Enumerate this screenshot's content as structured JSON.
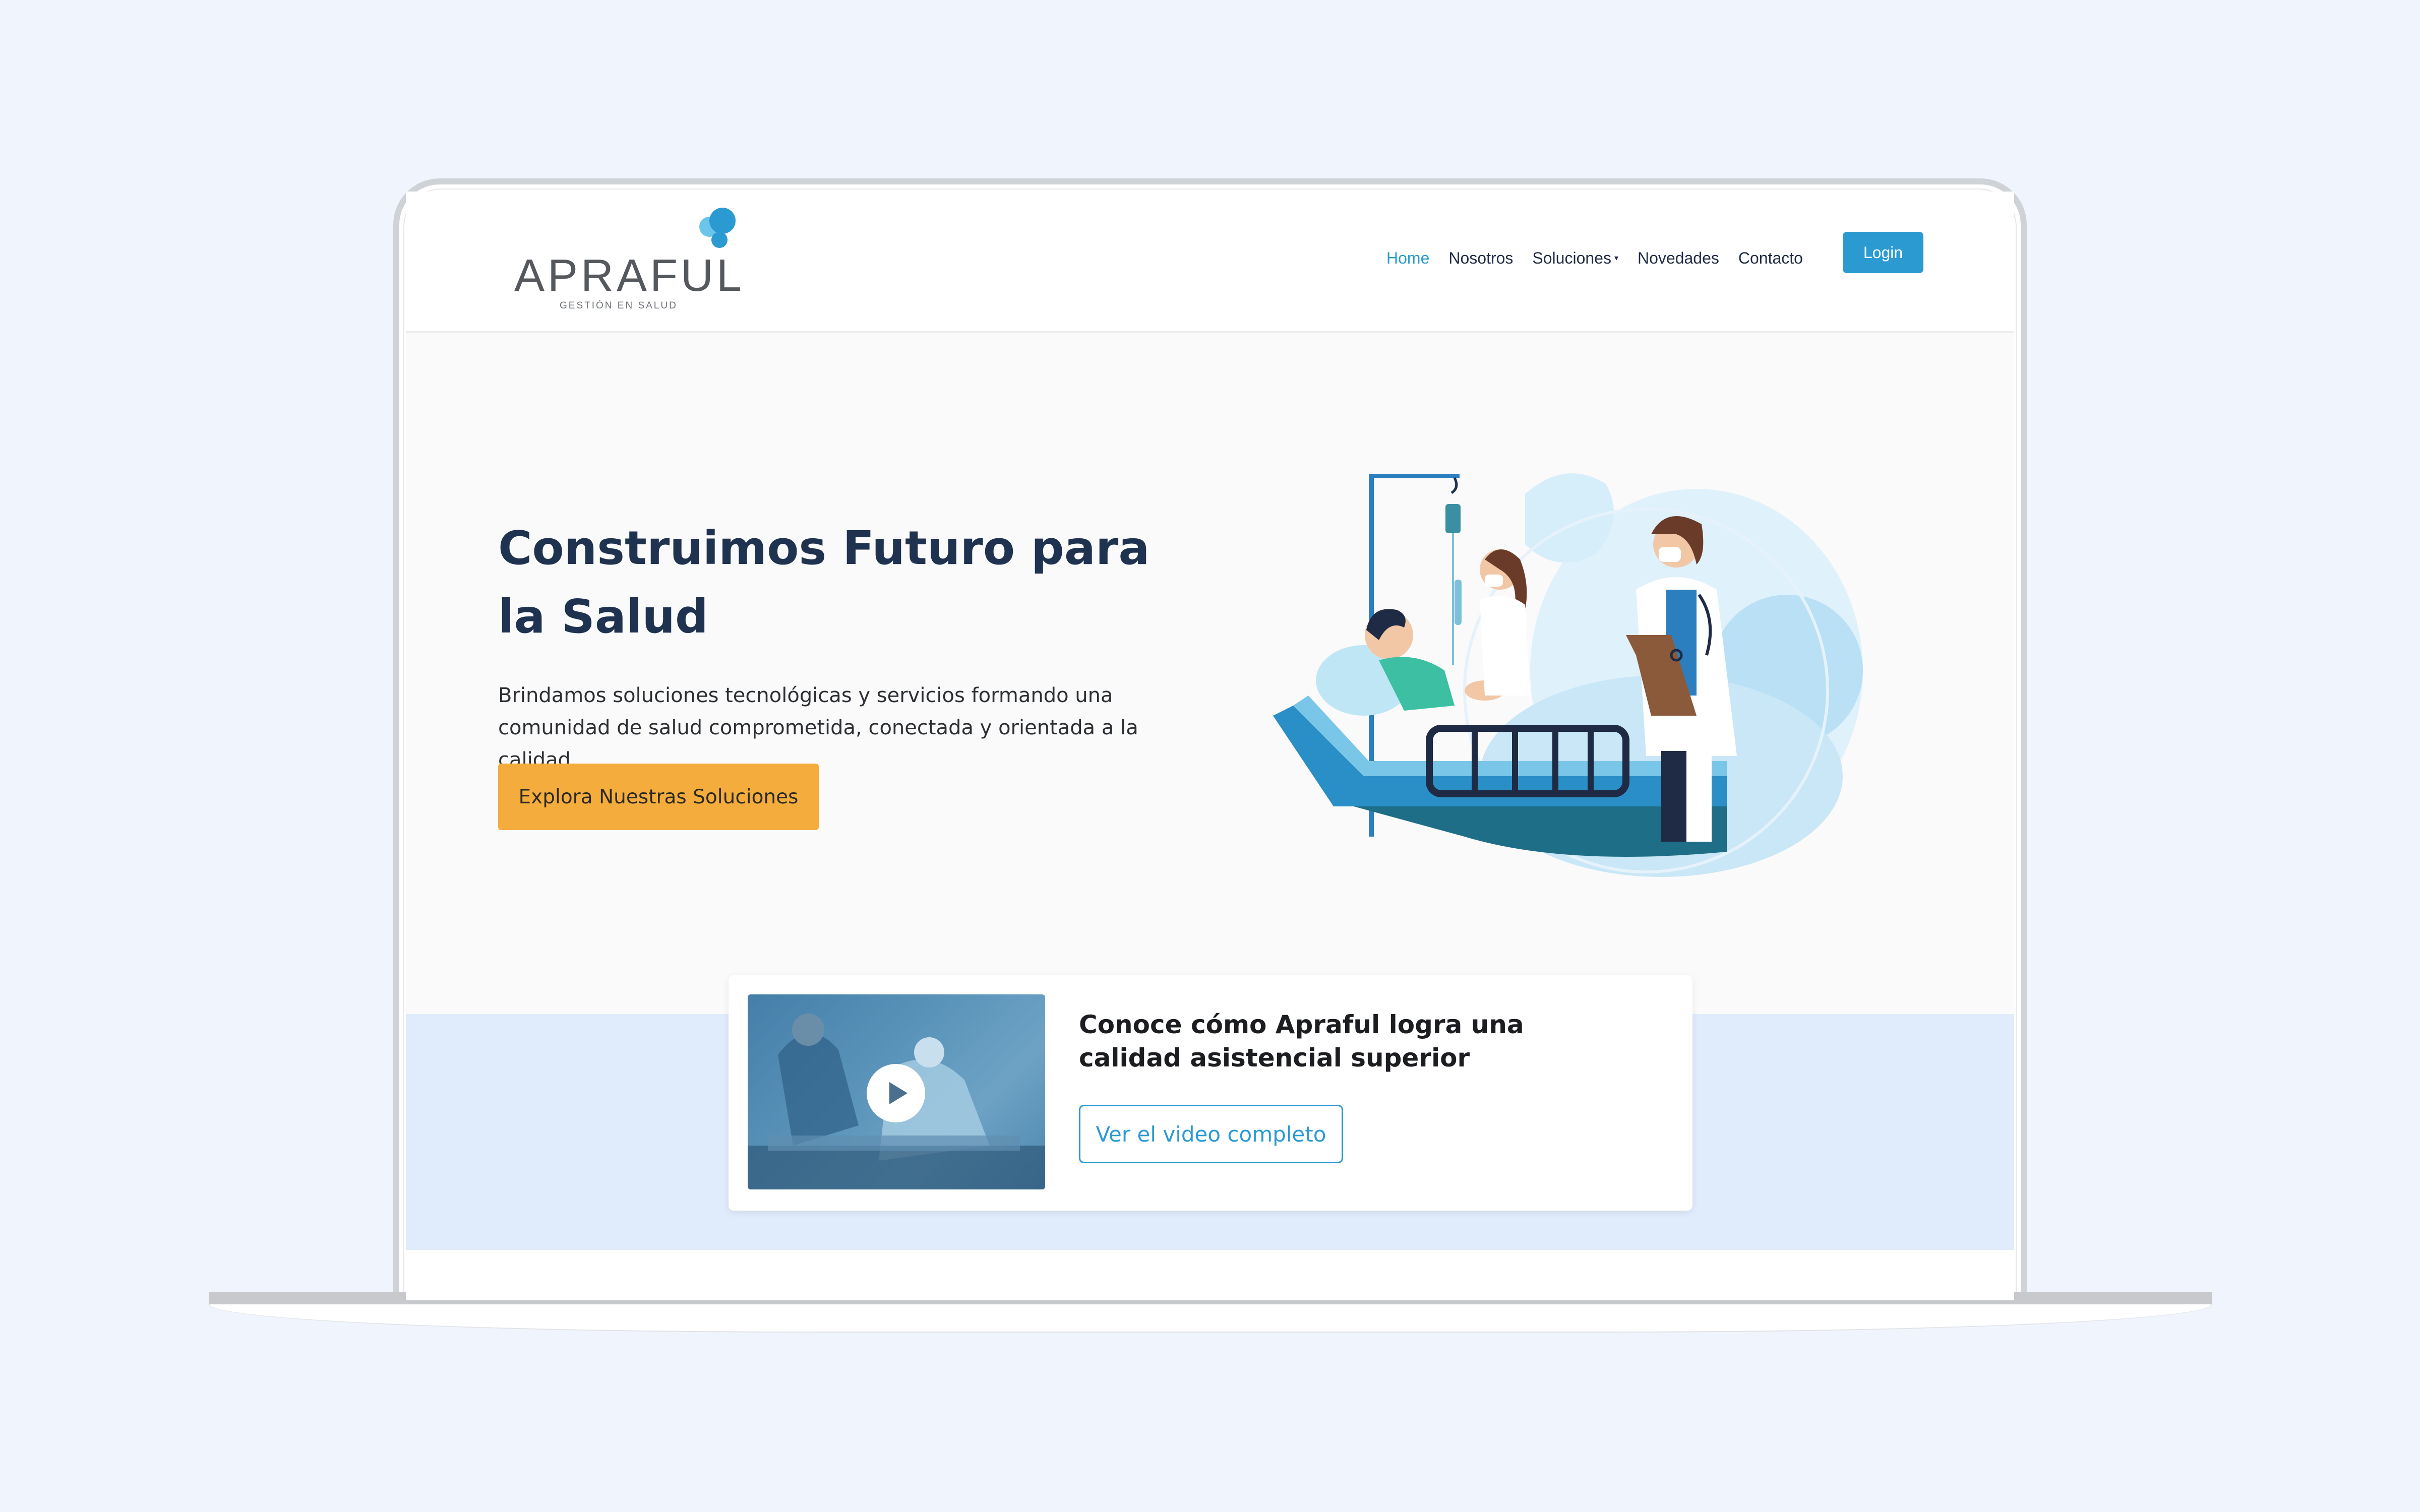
{
  "brand": {
    "name": "APRAFUL",
    "tagline": "GESTIÓN EN SALUD",
    "accent": "#2b9ad1",
    "cta_color": "#f4ad3d",
    "heading_color": "#1f3350"
  },
  "nav": {
    "items": [
      {
        "label": "Home",
        "active": true
      },
      {
        "label": "Nosotros"
      },
      {
        "label": "Soluciones",
        "has_dropdown": true
      },
      {
        "label": "Novedades"
      },
      {
        "label": "Contacto"
      }
    ],
    "login_label": "Login"
  },
  "hero": {
    "title": "Construimos Futuro para la Salud",
    "description": "Brindamos soluciones tecnológicas y servicios formando una comunidad de salud comprometida, conectada y orientada a la calidad",
    "cta_label": "Explora Nuestras Soluciones"
  },
  "video_card": {
    "title": "Conoce cómo Apraful logra una calidad asistencial superior",
    "button_label": "Ver el video completo"
  }
}
